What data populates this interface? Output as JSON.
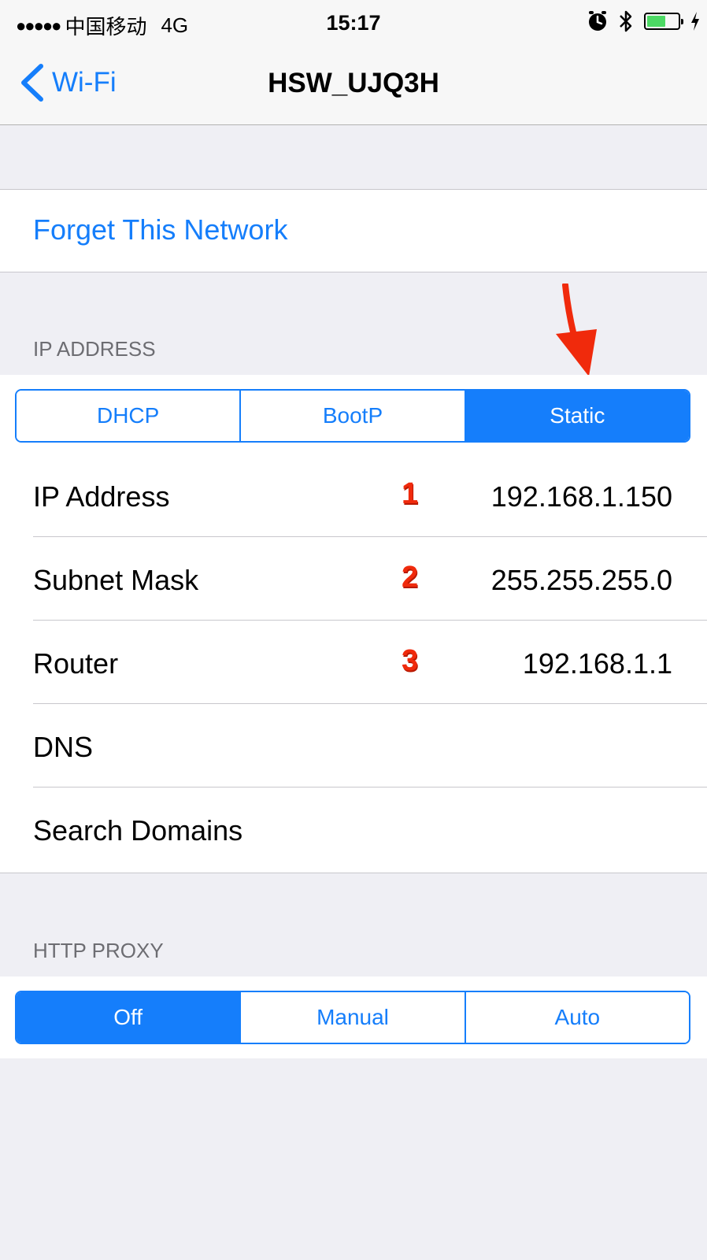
{
  "status_bar": {
    "signal": "●●●●●",
    "carrier": "中国移动",
    "network": "4G",
    "time": "15:17",
    "icons": [
      "alarm-icon",
      "bluetooth-icon",
      "battery-icon",
      "charging-icon"
    ],
    "battery_level": 0.6
  },
  "nav": {
    "back_label": "Wi-Fi",
    "title": "HSW_UJQ3H"
  },
  "forget_label": "Forget This Network",
  "ip_section": {
    "header": "IP ADDRESS",
    "segments": [
      "DHCP",
      "BootP",
      "Static"
    ],
    "selected": "Static",
    "rows": [
      {
        "label": "IP Address",
        "marker": "1",
        "value": "192.168.1.150"
      },
      {
        "label": "Subnet Mask",
        "marker": "2",
        "value": "255.255.255.0"
      },
      {
        "label": "Router",
        "marker": "3",
        "value": "192.168.1.1"
      },
      {
        "label": "DNS",
        "marker": "",
        "value": ""
      },
      {
        "label": "Search Domains",
        "marker": "",
        "value": ""
      }
    ]
  },
  "proxy_section": {
    "header": "HTTP PROXY",
    "segments": [
      "Off",
      "Manual",
      "Auto"
    ],
    "selected": "Off"
  },
  "colors": {
    "accent": "#157efb",
    "annotation": "#f02a0c",
    "background": "#efeff4"
  }
}
